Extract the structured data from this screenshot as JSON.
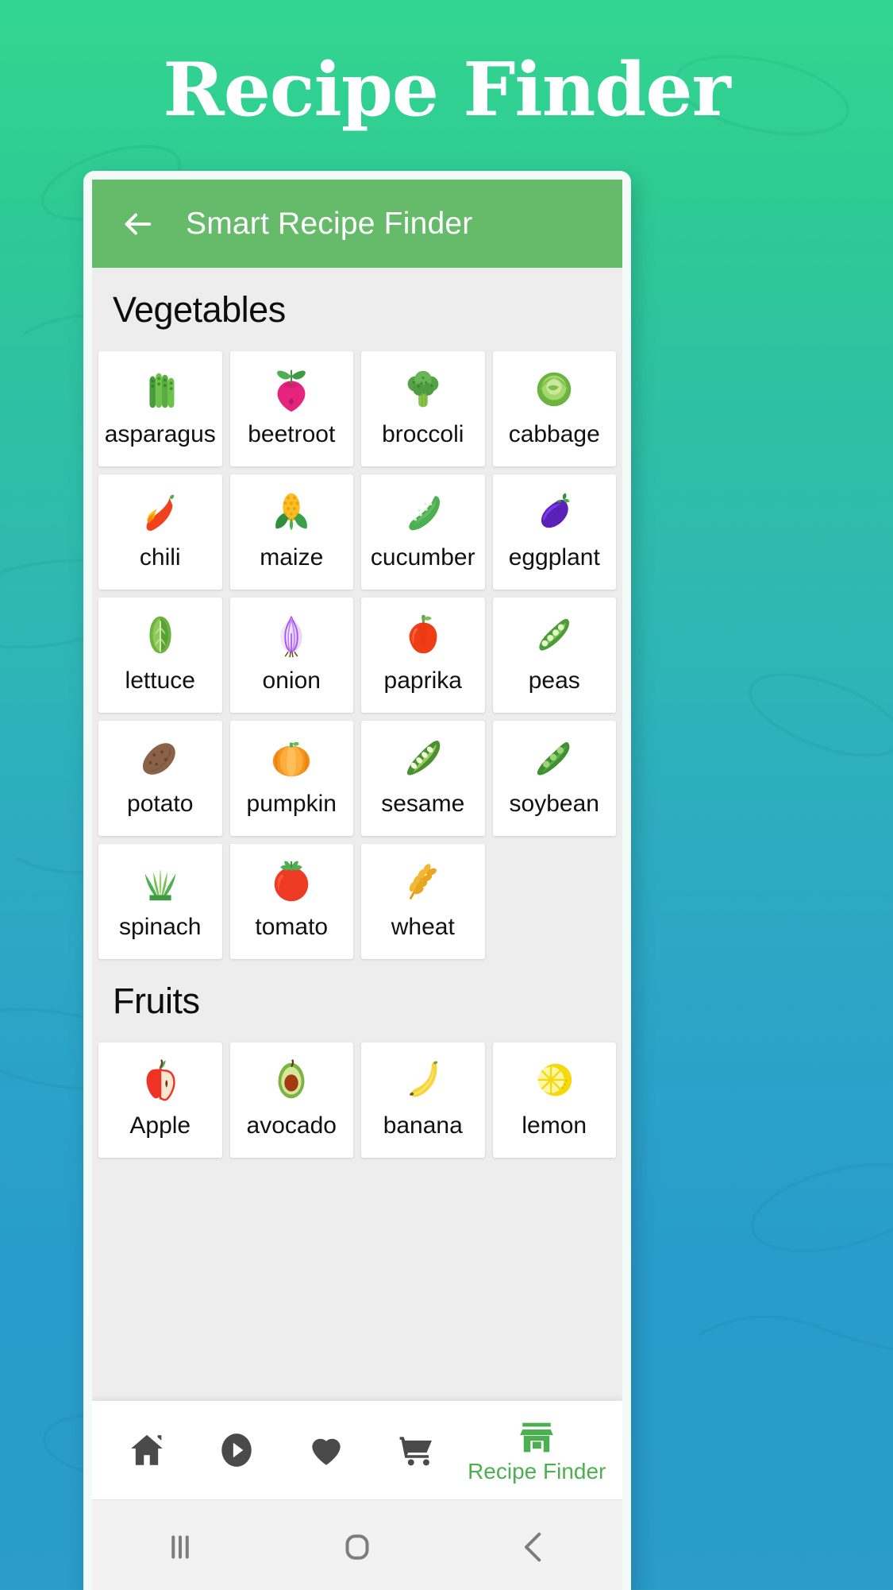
{
  "page": {
    "title": "Recipe Finder",
    "background_top_color": "#33d68f",
    "background_bottom_color": "#2b9ccb"
  },
  "appbar": {
    "back_icon": "arrow-left-icon",
    "title": "Smart Recipe Finder",
    "background_color": "#66bb6a",
    "text_color": "#ffffff"
  },
  "sections": [
    {
      "id": "vegetables",
      "title": "Vegetables",
      "items": [
        {
          "label": "asparagus",
          "icon": "asparagus-icon"
        },
        {
          "label": "beetroot",
          "icon": "beetroot-icon"
        },
        {
          "label": "broccoli",
          "icon": "broccoli-icon"
        },
        {
          "label": "cabbage",
          "icon": "cabbage-icon"
        },
        {
          "label": "chili",
          "icon": "chili-icon"
        },
        {
          "label": "maize",
          "icon": "maize-icon"
        },
        {
          "label": "cucumber",
          "icon": "cucumber-icon"
        },
        {
          "label": "eggplant",
          "icon": "eggplant-icon"
        },
        {
          "label": "lettuce",
          "icon": "lettuce-icon"
        },
        {
          "label": "onion",
          "icon": "onion-icon"
        },
        {
          "label": "paprika",
          "icon": "paprika-icon"
        },
        {
          "label": "peas",
          "icon": "peas-icon"
        },
        {
          "label": "potato",
          "icon": "potato-icon"
        },
        {
          "label": "pumpkin",
          "icon": "pumpkin-icon"
        },
        {
          "label": "sesame",
          "icon": "sesame-icon"
        },
        {
          "label": "soybean",
          "icon": "soybean-icon"
        },
        {
          "label": "spinach",
          "icon": "spinach-icon"
        },
        {
          "label": "tomato",
          "icon": "tomato-icon"
        },
        {
          "label": "wheat",
          "icon": "wheat-icon"
        }
      ]
    },
    {
      "id": "fruits",
      "title": "Fruits",
      "items": [
        {
          "label": "Apple",
          "icon": "apple-icon"
        },
        {
          "label": "avocado",
          "icon": "avocado-icon"
        },
        {
          "label": "banana",
          "icon": "banana-icon"
        },
        {
          "label": "lemon",
          "icon": "lemon-icon"
        }
      ]
    }
  ],
  "bottom_nav": {
    "active_color": "#4caf50",
    "inactive_color": "#4a4a4a",
    "items": [
      {
        "icon": "home-icon",
        "label": ""
      },
      {
        "icon": "play-circle-icon",
        "label": ""
      },
      {
        "icon": "heart-icon",
        "label": ""
      },
      {
        "icon": "shopping-cart-icon",
        "label": ""
      },
      {
        "icon": "store-icon",
        "label": "Recipe Finder"
      }
    ]
  },
  "system_nav": {
    "recents_icon": "recents-icon",
    "home_icon": "home-square-icon",
    "back_icon": "back-chevron-icon"
  }
}
